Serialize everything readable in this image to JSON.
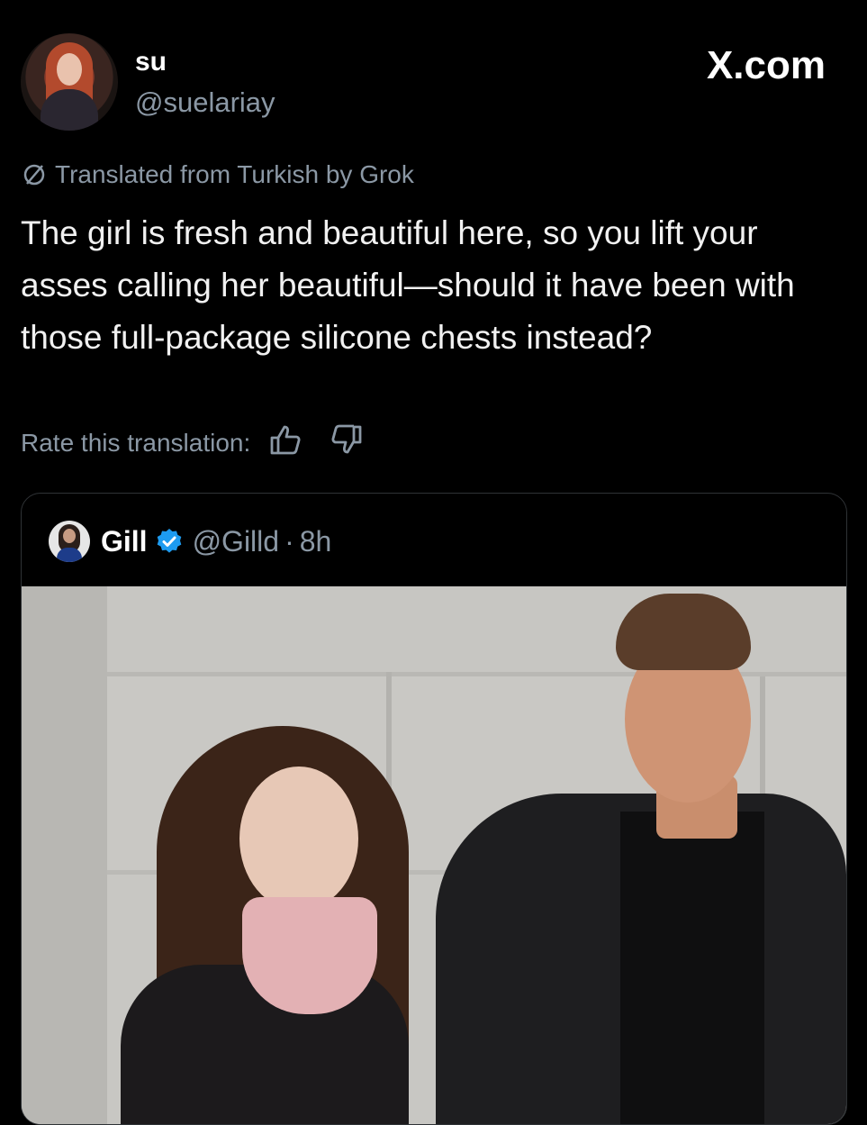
{
  "post": {
    "author_name": "su",
    "author_handle": "@suelariay",
    "site_label": "X.com",
    "translated_note": "Translated from Turkish by Grok",
    "text": "The girl is fresh and beautiful here, so you lift your asses calling her beautiful—should it have been with those full-package silicone chests instead?",
    "rate_label": "Rate this translation:"
  },
  "quoted": {
    "author_name": "Gill",
    "author_handle": "@Gilld",
    "separator": "·",
    "time": "8h"
  },
  "colors": {
    "background": "#000000",
    "text": "#e7e9ea",
    "muted": "#8b98a5",
    "verified": "#1d9bf0",
    "border": "#2f3336"
  },
  "icons": [
    "translate-icon",
    "thumbs-up-icon",
    "thumbs-down-icon",
    "verified-badge-icon"
  ]
}
